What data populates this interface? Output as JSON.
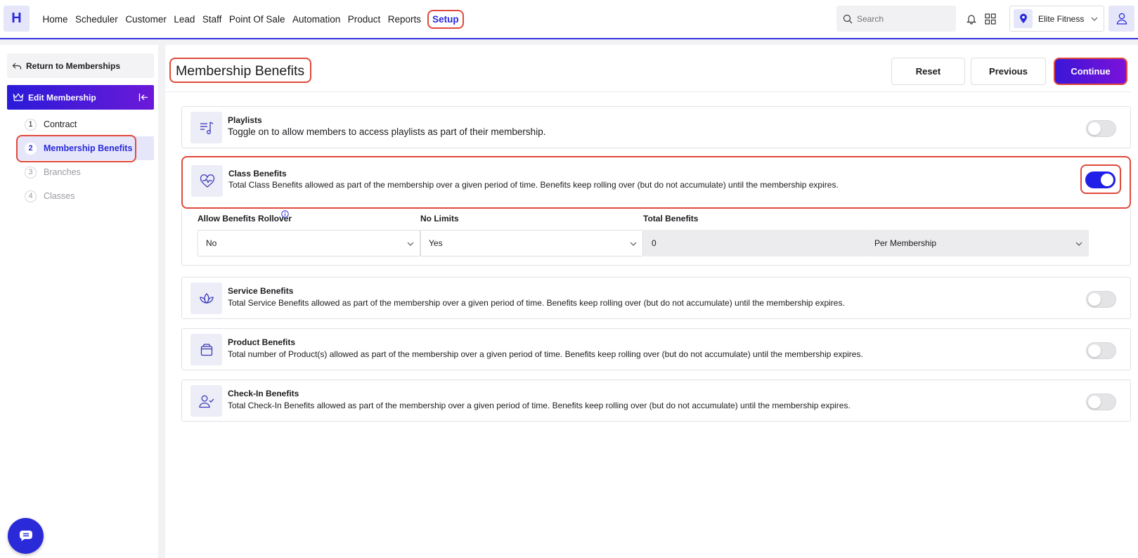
{
  "app": {
    "logo_letter": "H"
  },
  "nav": {
    "items": [
      "Home",
      "Scheduler",
      "Customer",
      "Lead",
      "Staff",
      "Point Of Sale",
      "Automation",
      "Product",
      "Reports"
    ],
    "active": "Setup"
  },
  "search": {
    "placeholder": "Search"
  },
  "location": {
    "name": "Elite Fitness"
  },
  "sidebar": {
    "return_label": "Return to Memberships",
    "edit_label": "Edit Membership",
    "steps": [
      {
        "num": "1",
        "label": "Contract"
      },
      {
        "num": "2",
        "label": "Membership Benefits"
      },
      {
        "num": "3",
        "label": "Branches"
      },
      {
        "num": "4",
        "label": "Classes"
      }
    ]
  },
  "main": {
    "title": "Membership Benefits",
    "reset_label": "Reset",
    "previous_label": "Previous",
    "continue_label": "Continue"
  },
  "benefits": [
    {
      "title": "Playlists",
      "desc": "Toggle on to allow members to access playlists as part of their membership.",
      "icon": "playlist-icon",
      "enabled": false
    },
    {
      "title": "Class Benefits",
      "desc": "Total Class Benefits allowed as part of the membership over a given period of time. Benefits keep rolling over (but do not accumulate) until the membership expires.",
      "icon": "heartbeat-icon",
      "enabled": true
    },
    {
      "title": "Service Benefits",
      "desc": "Total Service Benefits allowed as part of the membership over a given period of time. Benefits keep rolling over (but do not accumulate) until the membership expires.",
      "icon": "lotus-icon",
      "enabled": false
    },
    {
      "title": "Product Benefits",
      "desc": "Total number of Product(s) allowed as part of the membership over a given period of time. Benefits keep rolling over (but do not accumulate) until the membership expires.",
      "icon": "box-icon",
      "enabled": false
    },
    {
      "title": "Check-In Benefits",
      "desc": "Total Check-In Benefits allowed as part of the membership over a given period of time. Benefits keep rolling over (but do not accumulate) until the membership expires.",
      "icon": "user-check-icon",
      "enabled": false
    }
  ],
  "class_settings": {
    "rollover_label": "Allow Benefits Rollover",
    "rollover_value": "No",
    "nolimits_label": "No Limits",
    "nolimits_value": "Yes",
    "total_label": "Total Benefits",
    "total_value": "0",
    "period_value": "Per Membership"
  },
  "colors": {
    "accent": "#2a2ad9",
    "highlight": "#e04a3b"
  }
}
